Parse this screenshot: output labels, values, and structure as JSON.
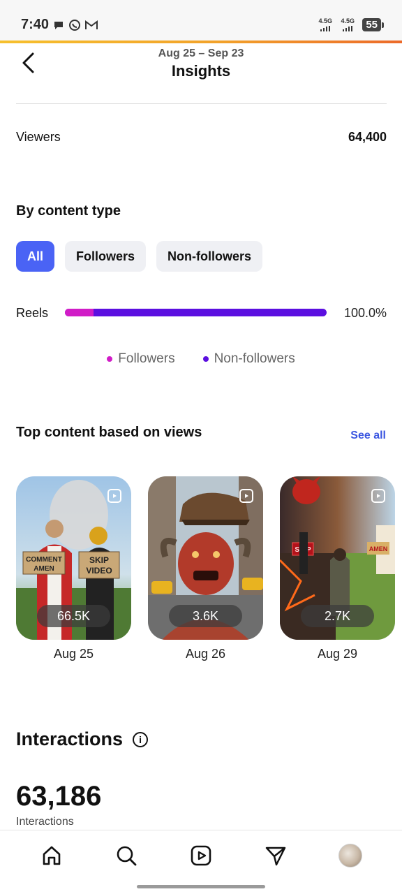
{
  "status_bar": {
    "time": "7:40",
    "network1": "4.5G",
    "network2": "4.5G",
    "battery": "55",
    "icons": [
      "message-icon",
      "whatsapp-icon",
      "gmail-icon"
    ]
  },
  "header": {
    "date_range": "Aug 25 – Sep 23",
    "title": "Insights"
  },
  "viewers": {
    "label": "Viewers",
    "value": "64,400"
  },
  "by_content_type": {
    "title": "By content type",
    "chips": [
      {
        "label": "All",
        "active": true
      },
      {
        "label": "Followers",
        "active": false
      },
      {
        "label": "Non-followers",
        "active": false
      }
    ],
    "reels": {
      "label": "Reels",
      "percent": "100.0%",
      "followers_fraction": 0.11
    },
    "legend": [
      {
        "label": "Followers",
        "color": "#d11cc7"
      },
      {
        "label": "Non-followers",
        "color": "#5b0fe0"
      }
    ]
  },
  "top_content": {
    "title": "Top content based on views",
    "see_all": "See all",
    "cards": [
      {
        "views": "66.5K",
        "date": "Aug 25",
        "sign_left": "COMMENT AMEN",
        "sign_right": "SKIP VIDEO"
      },
      {
        "views": "3.6K",
        "date": "Aug 26"
      },
      {
        "views": "2.7K",
        "date": "Aug 29",
        "sign_left": "SKIP",
        "sign_right": "AMEN"
      }
    ]
  },
  "interactions": {
    "title": "Interactions",
    "info_icon": "i",
    "value": "63,186",
    "label": "Interactions"
  },
  "bottom_nav": [
    "home-icon",
    "search-icon",
    "reels-icon",
    "messages-icon",
    "profile-avatar"
  ],
  "colors": {
    "accent": "#4a63f5",
    "followers": "#d11cc7",
    "non_followers": "#5b0fe0",
    "link": "#3b56e0"
  }
}
